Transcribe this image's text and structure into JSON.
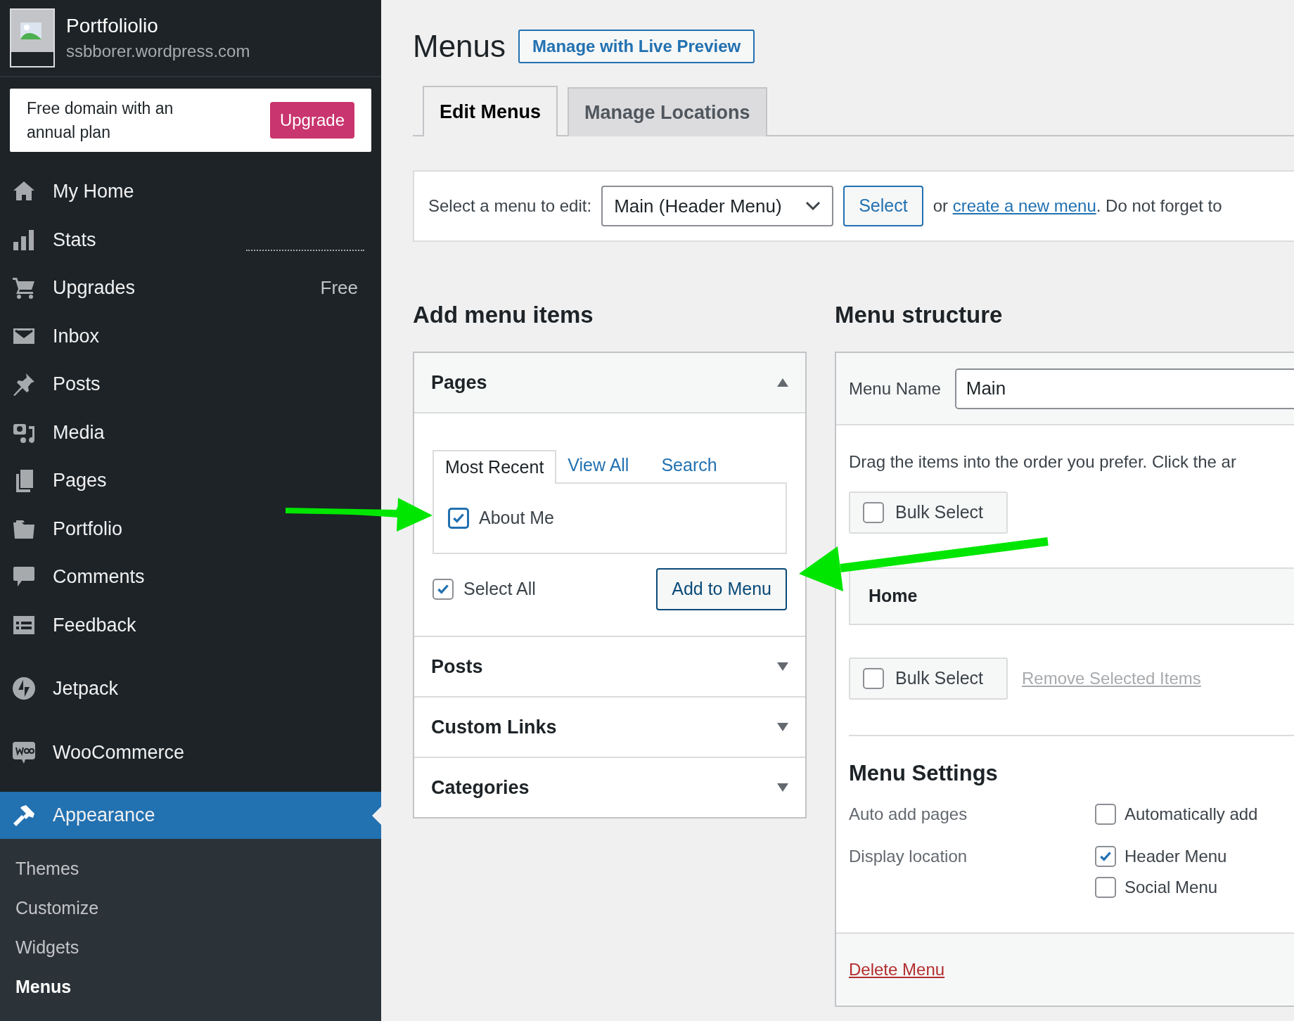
{
  "site": {
    "title": "Portfoliolio",
    "url": "ssbborer.wordpress.com"
  },
  "promo": {
    "text": "Free domain with an annual plan",
    "button": "Upgrade"
  },
  "sidebar": {
    "groups": [
      [
        {
          "label": "My Home",
          "selected": false
        },
        {
          "label": "Stats",
          "selected": false
        },
        {
          "label": "Upgrades",
          "badge": "Free",
          "selected": false
        },
        {
          "label": "Inbox",
          "selected": false
        },
        {
          "label": "Posts",
          "selected": false
        },
        {
          "label": "Media",
          "selected": false
        },
        {
          "label": "Pages",
          "selected": false
        },
        {
          "label": "Portfolio",
          "selected": false
        },
        {
          "label": "Comments",
          "selected": false
        },
        {
          "label": "Feedback",
          "selected": false
        }
      ],
      [
        {
          "label": "Jetpack",
          "selected": false
        }
      ],
      [
        {
          "label": "WooCommerce",
          "selected": false
        }
      ],
      [
        {
          "label": "Appearance",
          "selected": true,
          "children": [
            {
              "label": "Themes",
              "selected": false
            },
            {
              "label": "Customize",
              "selected": false
            },
            {
              "label": "Widgets",
              "selected": false
            },
            {
              "label": "Menus",
              "selected": true
            }
          ]
        }
      ]
    ]
  },
  "page": {
    "title": "Menus",
    "live_preview_button": "Manage with Live Preview",
    "tabs": [
      {
        "label": "Edit Menus",
        "selected": true
      },
      {
        "label": "Manage Locations",
        "selected": false
      }
    ],
    "select_bar": {
      "label": "Select a menu to edit:",
      "dropdown": "Main (Header Menu)",
      "button": "Select",
      "before": "or",
      "link": "create a new menu",
      "after": ". Do not forget to"
    }
  },
  "add_items": {
    "heading": "Add menu items",
    "sections": [
      {
        "title": "Pages",
        "expanded": true,
        "tabs": [
          {
            "label": "Most Recent",
            "selected": true
          },
          {
            "label": "View All",
            "selected": false
          },
          {
            "label": "Search",
            "selected": false
          }
        ],
        "items": [
          {
            "label": "About Me",
            "checked": true,
            "focused": true
          }
        ],
        "select_all": {
          "label": "Select All",
          "checked": true
        },
        "add_button": "Add to Menu"
      },
      {
        "title": "Posts",
        "expanded": false
      },
      {
        "title": "Custom Links",
        "expanded": false
      },
      {
        "title": "Categories",
        "expanded": false
      }
    ]
  },
  "menu_structure": {
    "heading": "Menu structure",
    "name_label": "Menu Name",
    "name_value": "Main",
    "instructions": "Drag the items into the order you prefer. Click the ar",
    "bulk_select_top": {
      "label": "Bulk Select",
      "checked": false
    },
    "items": [
      {
        "label": "Home"
      }
    ],
    "bulk_select_bottom": {
      "label": "Bulk Select",
      "checked": false
    },
    "remove_link": "Remove Selected Items",
    "settings": {
      "heading": "Menu Settings",
      "rows": [
        {
          "label": "Auto add pages",
          "options": [
            {
              "label": "Automatically add",
              "checked": false
            }
          ]
        },
        {
          "label": "Display location",
          "options": [
            {
              "label": "Header Menu",
              "checked": true
            },
            {
              "label": "Social Menu",
              "checked": false
            }
          ]
        }
      ]
    },
    "delete_link": "Delete Menu"
  }
}
